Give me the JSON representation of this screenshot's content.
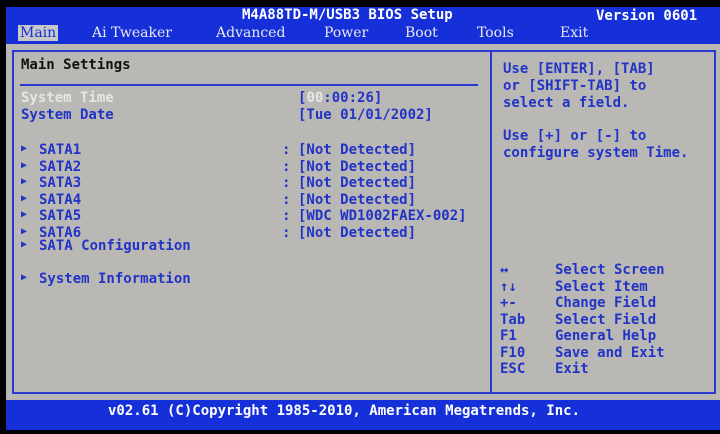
{
  "header": {
    "title": "M4A88TD-M/USB3 BIOS Setup",
    "version": "Version 0601"
  },
  "menu": [
    "Main",
    "Ai Tweaker",
    "Advanced",
    "Power",
    "Boot",
    "Tools",
    "Exit"
  ],
  "main": {
    "section_title": "Main Settings",
    "system_time": {
      "label": "System Time",
      "value_hour": "00",
      "value_rest": ":00:26]",
      "open_bracket": "["
    },
    "system_date": {
      "label": "System Date",
      "value": "[Tue 01/01/2002]"
    },
    "sata": [
      {
        "label": "SATA1",
        "value": "[Not Detected]"
      },
      {
        "label": "SATA2",
        "value": "[Not Detected]"
      },
      {
        "label": "SATA3",
        "value": "[Not Detected]"
      },
      {
        "label": "SATA4",
        "value": "[Not Detected]"
      },
      {
        "label": "SATA5",
        "value": "[WDC WD1002FAEX-002]"
      },
      {
        "label": "SATA6",
        "value": "[Not Detected]"
      }
    ],
    "sata_config": "SATA Configuration",
    "system_info": "System Information",
    "arrow": "▶",
    "colon": ":"
  },
  "help": {
    "lines1": [
      "Use [ENTER], [TAB]",
      "or [SHIFT-TAB] to",
      "select a field."
    ],
    "lines2": [
      "Use [+] or [-] to",
      "configure system Time."
    ],
    "keys": [
      {
        "key": "↔",
        "desc": "Select Screen"
      },
      {
        "key": "↑↓",
        "desc": "Select Item"
      },
      {
        "key": "+-",
        "desc": "Change Field"
      },
      {
        "key": "Tab",
        "desc": "Select Field"
      },
      {
        "key": "F1",
        "desc": "General Help"
      },
      {
        "key": "F10",
        "desc": "Save and Exit"
      },
      {
        "key": "ESC",
        "desc": "Exit"
      }
    ]
  },
  "footer": "v02.61 (C)Copyright 1985-2010, American Megatrends, Inc."
}
